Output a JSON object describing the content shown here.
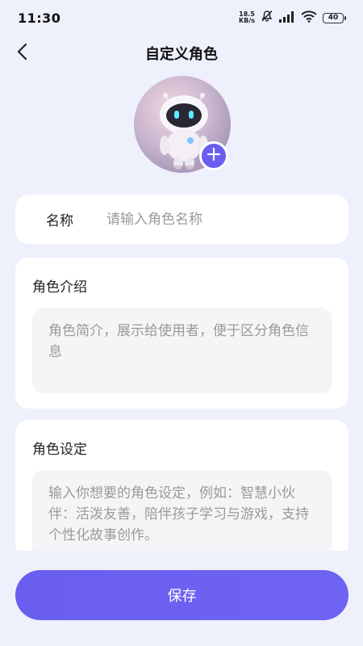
{
  "status_bar": {
    "time": "11:30",
    "net_speed_value": "18.5",
    "net_speed_unit": "KB/s",
    "battery": "40"
  },
  "header": {
    "title": "自定义角色",
    "back_icon": "chevron-left-icon"
  },
  "avatar": {
    "image": "robot-avatar",
    "add_icon": "plus-icon",
    "accent": "#6a5ef0"
  },
  "form": {
    "name": {
      "label": "名称",
      "placeholder": "请输入角色名称",
      "value": ""
    },
    "intro": {
      "title": "角色介绍",
      "placeholder": "角色简介，展示给使用者，便于区分角色信息",
      "value": ""
    },
    "setting": {
      "title": "角色设定",
      "placeholder": "输入你想要的角色设定，例如：智慧小伙伴：活泼友善，陪伴孩子学习与游戏，支持个性化故事创作。",
      "value": ""
    }
  },
  "actions": {
    "save_label": "保存"
  },
  "colors": {
    "background": "#eef0fb",
    "primary": "#6a5ef0",
    "card": "#ffffff",
    "input_bg": "#f5f5f7"
  }
}
